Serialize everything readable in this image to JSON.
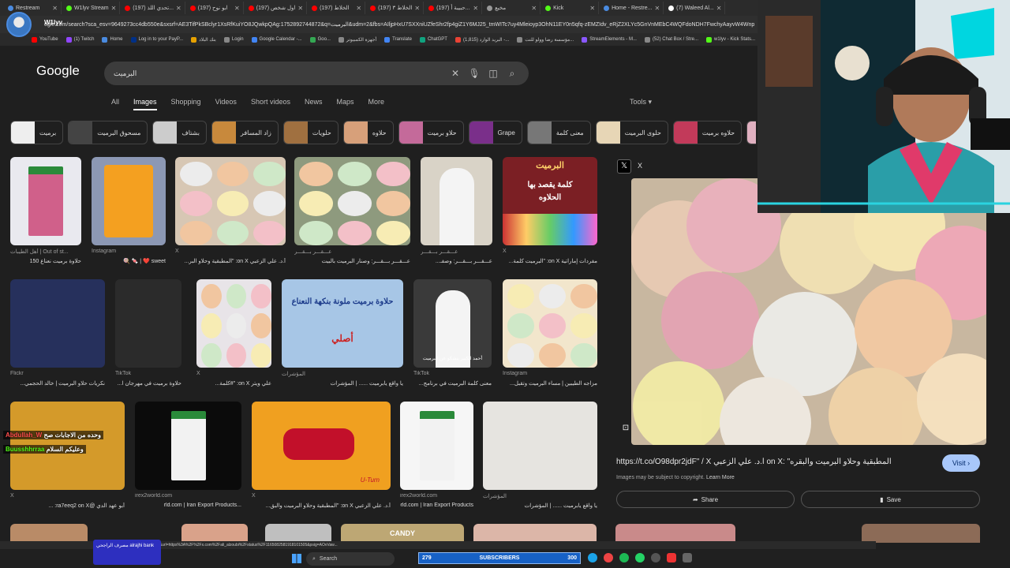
{
  "browser": {
    "tabs": [
      {
        "label": "Restream",
        "color": "#4a8be0"
      },
      {
        "label": "W1lyv Stream",
        "color": "#53fc18"
      },
      {
        "label": "(197) تحدي اللذ...",
        "color": "#ff0000"
      },
      {
        "label": "(197) ابو نوح",
        "color": "#ff0000"
      },
      {
        "label": "(197) اول شخص",
        "color": "#ff0000"
      },
      {
        "label": "(197) الخلاط",
        "color": "#ff0000"
      },
      {
        "label": "(197) الخلاط ٣",
        "color": "#ff0000"
      },
      {
        "label": "(197) حبيبة أ...",
        "color": "#ff0000"
      },
      {
        "label": "مخيع",
        "color": "#999999"
      },
      {
        "label": "Kick",
        "color": "#53fc18"
      },
      {
        "label": "Home - Restre...",
        "color": "#4a8be0"
      },
      {
        "label": "(7) Waleed Al...",
        "color": "#ffffff"
      }
    ],
    "channel": "W1lyv",
    "url": "ogle.com/search?sca_esv=9649273cc4db550e&sxsrf=AE3TifPkSBclyr1XsRfKuiYO8JQwkpQAg:1752892744872&q=البرميت&udm=2&fbs=AIljpHxU7SXXniUZfeShr2fp4giZ1Y6MJ25_tmWITc7uy4Mleioyp3OhN11EY0n5qfq-zEMZIdv_eRjZ2XLYc5GnVnMEbC4WQFdoNDH7FwchyAayvW4Wnp",
    "bookmarks": [
      {
        "label": "YouTube",
        "color": "#ff0000"
      },
      {
        "label": "(1) Twitch",
        "color": "#9146ff"
      },
      {
        "label": "Home",
        "color": "#4a8be0"
      },
      {
        "label": "Log in to your PayP...",
        "color": "#003087"
      },
      {
        "label": "بنك البلاد",
        "color": "#e6a100"
      },
      {
        "label": "Login",
        "color": "#888888"
      },
      {
        "label": "Google Calendar -...",
        "color": "#4285f4"
      },
      {
        "label": "Goo...",
        "color": "#34a853"
      },
      {
        "label": "أجهزة الكمبيوتر",
        "color": "#888888"
      },
      {
        "label": "Translate",
        "color": "#4285f4"
      },
      {
        "label": "ChatGPT",
        "color": "#10a37f"
      },
      {
        "label": "البريد الوارد (1,815) -...",
        "color": "#ea4335"
      },
      {
        "label": "مؤسسة رضا وولو للنت...",
        "color": "#888888"
      },
      {
        "label": "StreamElements - M...",
        "color": "#8a58ff"
      },
      {
        "label": "(52) Chat Box / Stre...",
        "color": "#888888"
      },
      {
        "label": "w1lyv - Kick Stats...",
        "color": "#53fc18"
      },
      {
        "label": "Kick",
        "color": "#53fc18"
      }
    ]
  },
  "google": {
    "logo": "Google",
    "query": "البرميت",
    "filters": [
      "All",
      "Images",
      "Shopping",
      "Videos",
      "Short videos",
      "News",
      "Maps",
      "More"
    ],
    "tools": "Tools",
    "chips": [
      "برميت",
      "مسحوق البرميت",
      "بشتاف",
      "زاد المسافر",
      "حلويات",
      "حلاوه",
      "حلاو برميت",
      "Grape",
      "معنى كلمة",
      "حلوى البرميت",
      "حلاوه برميت",
      "نعناع"
    ]
  },
  "results": [
    {
      "source": "أهل الطيبات | Out of st...",
      "title": "حلاوة برميت نعناع 150"
    },
    {
      "source": "Instagram",
      "title": "sweet ❤️ | 🍬 🍭"
    },
    {
      "source": "X",
      "title": "أ.د. علي الزعبي on X: \"المطبقية وحلاو البر..."
    },
    {
      "source": "عـــقـــر بـــقـــر",
      "title": "عـــقـــر بـــقـــر: وصنار البرميت بالبيت"
    },
    {
      "source": "عـــقـــر بـــقـــر",
      "title": "عـــقـــر بـــقـــر: وصفـ..."
    },
    {
      "source": "X",
      "title": "مفردات إماراتية on X: \"البرميت كلمة..."
    },
    {
      "source": "Flickr",
      "title": "نكريات حلاو البرميت | خالد الحجمي..."
    },
    {
      "source": "TikTok",
      "title": "حلاوة برميت في مهرجان ا..."
    },
    {
      "source": "X",
      "title": "علي ويتر on X: \"#كلمة..."
    },
    {
      "source": "المؤشرات",
      "title": "يا واقع يابرميت ...... | المؤشرات"
    },
    {
      "source": "TikTok",
      "title": "معنى كلمة البرميت في برنامج..."
    },
    {
      "source": "Instagram",
      "title": "مزاجه الطيبين | مساء البرميت وتقبل..."
    },
    {
      "source": "X",
      "title": "أبو عهد الدي @ra7eeq2 on X: ..."
    },
    {
      "source": "irex2world.com",
      "title": "...rld.com | Iran Export Products"
    },
    {
      "source": "X",
      "title": "أ.د. علي الزعبي on X: \"المطبقية وحلاو البرميت والبق..."
    },
    {
      "source": "irex2world.com",
      "title": "irex2world.com | Iran Export Products"
    },
    {
      "source": "المؤشرات",
      "title": "يا واقع يابرميت ...... | المؤشرات"
    }
  ],
  "image_labels": {
    "card6_top": "البرميت",
    "card6_mid": "كلمة يقصد بها",
    "card6_bot": "الحلاوه",
    "card10": "حلاوة برميت ملونة بنكهة النعناع",
    "card10_sub": "أصلي",
    "card11": "أحمد الكبير يتشكو عن البرميت",
    "card15": "U-Turn",
    "candy": "CANDY"
  },
  "panel": {
    "source": "X",
    "url": "https://t.co/O98dpr2jdF\" / X أ.د. علي الزعبي on X: \"المطبقية وحلاو البرميت والبقره",
    "visit": "Visit",
    "copyright": "Images may be subject to copyright.",
    "learn_more": "Learn More",
    "share": "Share",
    "save": "Save"
  },
  "chat": [
    {
      "user": "Abdullah_W",
      "msg": "وحده من الاجابات صح",
      "color": "#ff4d4d"
    },
    {
      "user": "Buusshhrraa",
      "msg": "وعليكم السلام",
      "color": "#53fc18"
    }
  ],
  "overlay": {
    "bank_label": "مصرف الراجحي alrajhi bank",
    "subscribers_count": "279",
    "subscribers_label": "SUBSCRIBERS",
    "subscribers_goal": "300"
  },
  "status_url": "https://www.google.com/url?sa=i&url=https%3A%2F%2Fx.com%2Fali_alzoubi%2Fstatus%2F1165082581918101505&psig=AOvVaw...",
  "taskbar": {
    "search": "Search"
  }
}
